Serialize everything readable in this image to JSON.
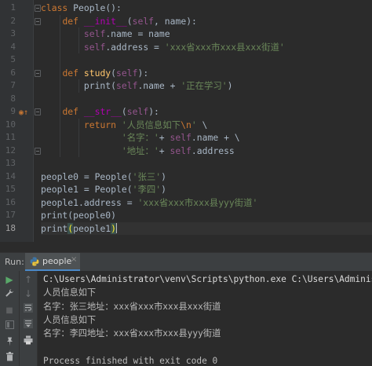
{
  "editor": {
    "line_numbers": [
      "1",
      "2",
      "3",
      "4",
      "5",
      "6",
      "7",
      "8",
      "9",
      "10",
      "11",
      "12",
      "13",
      "14",
      "15",
      "16",
      "17",
      "18"
    ],
    "current_line": "18",
    "lines": [
      [
        {
          "t": "class ",
          "c": "kw"
        },
        {
          "t": "People",
          "c": ""
        },
        {
          "t": "():",
          "c": ""
        }
      ],
      [
        {
          "t": "    ",
          "c": ""
        },
        {
          "t": "def ",
          "c": "kw"
        },
        {
          "t": "__init__",
          "c": "magic"
        },
        {
          "t": "(",
          "c": ""
        },
        {
          "t": "self",
          "c": "self"
        },
        {
          "t": ", ",
          "c": ""
        },
        {
          "t": "name):",
          "c": ""
        }
      ],
      [
        {
          "t": "        ",
          "c": ""
        },
        {
          "t": "self",
          "c": "self"
        },
        {
          "t": ".name = name",
          "c": ""
        }
      ],
      [
        {
          "t": "        ",
          "c": ""
        },
        {
          "t": "self",
          "c": "self"
        },
        {
          "t": ".address = ",
          "c": ""
        },
        {
          "t": "'xxx省xxx市xxx县xxx街道'",
          "c": "str"
        }
      ],
      [],
      [
        {
          "t": "    ",
          "c": ""
        },
        {
          "t": "def ",
          "c": "kw"
        },
        {
          "t": "study",
          "c": "fn"
        },
        {
          "t": "(",
          "c": ""
        },
        {
          "t": "self",
          "c": "self"
        },
        {
          "t": "):",
          "c": ""
        }
      ],
      [
        {
          "t": "        print(",
          "c": ""
        },
        {
          "t": "self",
          "c": "self"
        },
        {
          "t": ".name + ",
          "c": ""
        },
        {
          "t": "'正在学习'",
          "c": "str"
        },
        {
          "t": ")",
          "c": ""
        }
      ],
      [],
      [
        {
          "t": "    ",
          "c": ""
        },
        {
          "t": "def ",
          "c": "kw"
        },
        {
          "t": "__str__",
          "c": "magic"
        },
        {
          "t": "(",
          "c": ""
        },
        {
          "t": "self",
          "c": "self"
        },
        {
          "t": "):",
          "c": ""
        }
      ],
      [
        {
          "t": "        ",
          "c": ""
        },
        {
          "t": "return ",
          "c": "kw"
        },
        {
          "t": "'人员信息如下",
          "c": "str"
        },
        {
          "t": "\\n",
          "c": "kw"
        },
        {
          "t": "' ",
          "c": "str"
        },
        {
          "t": "\\",
          "c": ""
        }
      ],
      [
        {
          "t": "               ",
          "c": ""
        },
        {
          "t": "'名字：'",
          "c": "str"
        },
        {
          "t": "+ ",
          "c": ""
        },
        {
          "t": "self",
          "c": "self"
        },
        {
          "t": ".name + \\",
          "c": ""
        }
      ],
      [
        {
          "t": "               ",
          "c": ""
        },
        {
          "t": "'地址：'",
          "c": "str"
        },
        {
          "t": "+ ",
          "c": ""
        },
        {
          "t": "self",
          "c": "self"
        },
        {
          "t": ".address",
          "c": ""
        }
      ],
      [],
      [
        {
          "t": "people0 = People(",
          "c": ""
        },
        {
          "t": "'张三'",
          "c": "str"
        },
        {
          "t": ")",
          "c": ""
        }
      ],
      [
        {
          "t": "people1 = People(",
          "c": ""
        },
        {
          "t": "'李四'",
          "c": "str"
        },
        {
          "t": ")",
          "c": ""
        }
      ],
      [
        {
          "t": "people1.address = ",
          "c": ""
        },
        {
          "t": "'xxx省xxx市xxx县yyy街道'",
          "c": "str"
        }
      ],
      [
        {
          "t": "print(people0)",
          "c": ""
        }
      ],
      [
        {
          "t": "print",
          "c": ""
        },
        {
          "t": "(",
          "c": "paren"
        },
        {
          "t": "people1",
          "c": ""
        },
        {
          "t": ")",
          "c": "paren"
        }
      ]
    ]
  },
  "run": {
    "label": "Run:",
    "tab_name": "people",
    "tab_close": "×",
    "console_lines": [
      {
        "text": "C:\\Users\\Administrator\\venv\\Scripts\\python.exe C:\\Users\\Administrator\\",
        "kind": "path"
      },
      {
        "text": "人员信息如下",
        "kind": "out"
      },
      {
        "text": "名字：张三地址：xxx省xxx市xxx县xxx街道",
        "kind": "out"
      },
      {
        "text": "人员信息如下",
        "kind": "out"
      },
      {
        "text": "名字：李四地址：xxx省xxx市xxx县yyy街道",
        "kind": "out"
      },
      {
        "text": "",
        "kind": "out"
      },
      {
        "text": "Process finished with exit code 0",
        "kind": "out"
      }
    ]
  },
  "icons": {
    "rerun": "▶",
    "wrench": "🔧",
    "stop": "■",
    "pin": "📌",
    "trash": "🗑",
    "up": "↑",
    "down": "↓",
    "soft_wrap": "≡",
    "scroll_end": "⇊",
    "print": "⎙"
  },
  "colors": {
    "accent": "#4a88c7",
    "keyword": "#cc7832",
    "string": "#6a8759",
    "self": "#94558d",
    "function": "#ffc66d",
    "run_green": "#59a869"
  }
}
